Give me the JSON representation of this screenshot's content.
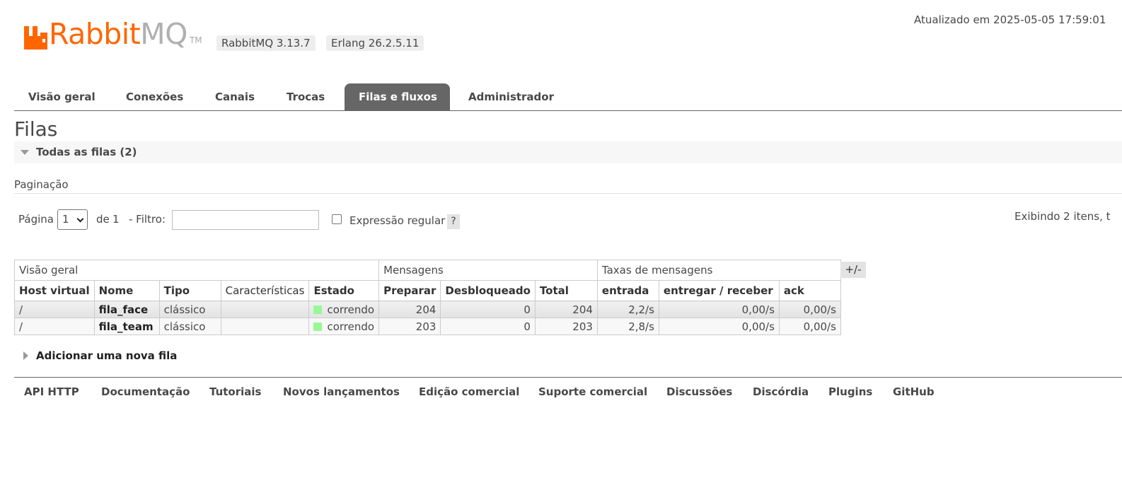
{
  "header": {
    "logo_rabbit": "Rabbit",
    "logo_mq": "MQ",
    "logo_tm": "TM",
    "rabbitmq_version": "RabbitMQ 3.13.7",
    "erlang_version": "Erlang 26.2.5.11",
    "updated_text": "Atualizado em 2025-05-05 17:59:01"
  },
  "tabs": [
    {
      "label": "Visão geral",
      "active": false
    },
    {
      "label": "Conexões",
      "active": false
    },
    {
      "label": "Canais",
      "active": false
    },
    {
      "label": "Trocas",
      "active": false
    },
    {
      "label": "Filas e fluxos",
      "active": true
    },
    {
      "label": "Administrador",
      "active": false
    }
  ],
  "page_title": "Filas",
  "section": {
    "title": "Todas as filas (2)"
  },
  "pagination": {
    "label": "Paginação",
    "page_label": "Página",
    "page_value": "1",
    "of_label": "de",
    "total_pages": "1",
    "filter_label": "- Filtro:",
    "filter_value": "",
    "regex_label": "Expressão regular",
    "regex_checked": false,
    "help_label": "?",
    "showing_text": "Exibindo 2 itens, t"
  },
  "table": {
    "groups": {
      "overview": "Visão geral",
      "messages": "Mensagens",
      "rates": "Taxas de mensagens"
    },
    "columns": {
      "vhost": "Host virtual",
      "name": "Nome",
      "type": "Tipo",
      "features": "Características",
      "state": "Estado",
      "ready": "Preparar",
      "unacked": "Desbloqueado",
      "total": "Total",
      "incoming": "entrada",
      "deliver": "entregar / receber",
      "ack": "ack"
    },
    "toggle_label": "+/-",
    "rows": [
      {
        "vhost": "/",
        "name": "fila_face",
        "type": "clássico",
        "features": "",
        "state": "correndo",
        "ready": "204",
        "unacked": "0",
        "total": "204",
        "incoming": "2,2/s",
        "deliver": "0,00/s",
        "ack": "0,00/s"
      },
      {
        "vhost": "/",
        "name": "fila_team",
        "type": "clássico",
        "features": "",
        "state": "correndo",
        "ready": "203",
        "unacked": "0",
        "total": "203",
        "incoming": "2,8/s",
        "deliver": "0,00/s",
        "ack": "0,00/s"
      }
    ]
  },
  "add_queue": {
    "label": "Adicionar uma nova fila"
  },
  "footer": {
    "links": [
      "API HTTP",
      "Documentação",
      "Tutoriais",
      "Novos lançamentos",
      "Edição comercial",
      "Suporte comercial",
      "Discussões",
      "Discórdia",
      "Plugins",
      "GitHub"
    ]
  },
  "colors": {
    "brand_orange": "#ff6600",
    "tab_active_bg": "#666666",
    "state_running": "#98f898"
  }
}
